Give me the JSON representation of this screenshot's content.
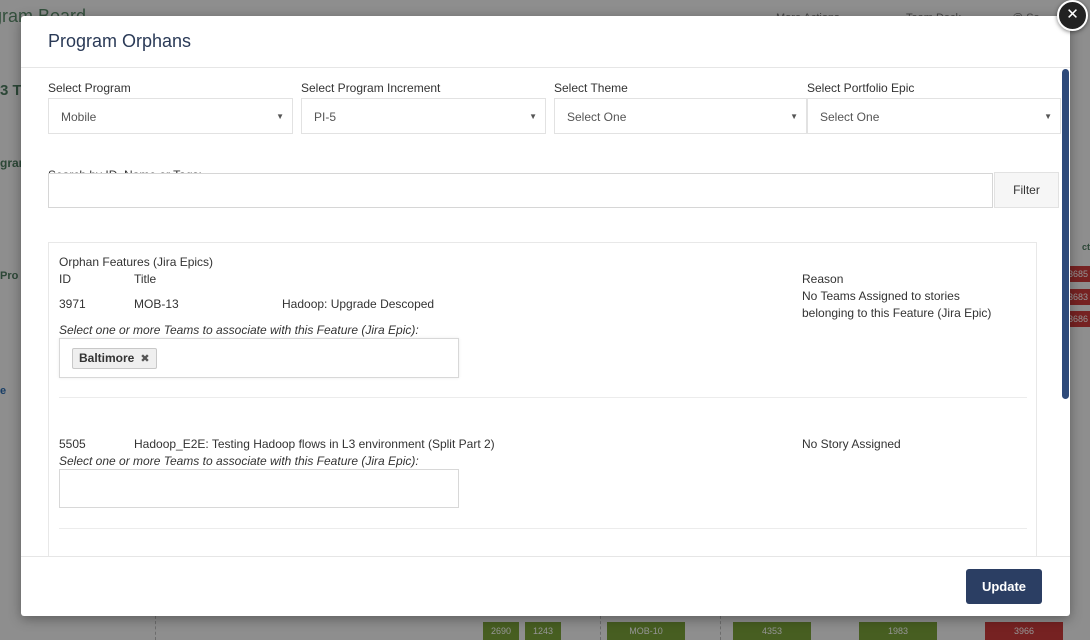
{
  "background": {
    "title": "gram Board",
    "nav": [
      "More Actions",
      "Team Deck",
      "@ Se"
    ],
    "side_labels": [
      "3 To",
      "gram",
      "Pro",
      "e"
    ],
    "red_badges": [
      "3685",
      "3683",
      "3686"
    ],
    "col_head": "ct",
    "chips": [
      "2690",
      "1243",
      "MOB-10",
      "4353",
      "1983",
      "3966"
    ]
  },
  "modal": {
    "title": "Program Orphans",
    "close_icon": "close-icon",
    "filters": {
      "program": {
        "label": "Select Program",
        "value": "Mobile"
      },
      "increment": {
        "label": "Select Program Increment",
        "value": "PI-5"
      },
      "theme": {
        "label": "Select Theme",
        "value": "Select One"
      },
      "epic": {
        "label": "Select Portfolio Epic",
        "value": "Select One"
      }
    },
    "search": {
      "label": "Search by ID, Name or Tags:",
      "value": "",
      "placeholder": ""
    },
    "filter_button": "Filter",
    "panel": {
      "heading": "Orphan Features (Jira Epics)",
      "col_id": "ID",
      "col_title": "Title",
      "col_reason": "Reason",
      "rows": [
        {
          "id": "3971",
          "key": "MOB-13",
          "title": "Hadoop: Upgrade Descoped",
          "reason_line1": "No Teams Assigned to stories",
          "reason_line2": "belonging to this Feature (Jira Epic)",
          "prompt": "Select one or more Teams to associate with this Feature (Jira Epic):",
          "teams": [
            "Baltimore"
          ]
        },
        {
          "id": "5505",
          "title": "Hadoop_E2E: Testing Hadoop flows in L3 environment (Split Part 2)",
          "reason_line1": "No Story Assigned",
          "prompt": "Select one or more Teams to associate with this Feature (Jira Epic):",
          "teams": []
        }
      ]
    },
    "update_button": "Update"
  },
  "colors": {
    "primary": "#2b3e63",
    "title": "#2a3a57",
    "badge_red": "#cc3b3b",
    "chip_green": "#7ba33a"
  }
}
